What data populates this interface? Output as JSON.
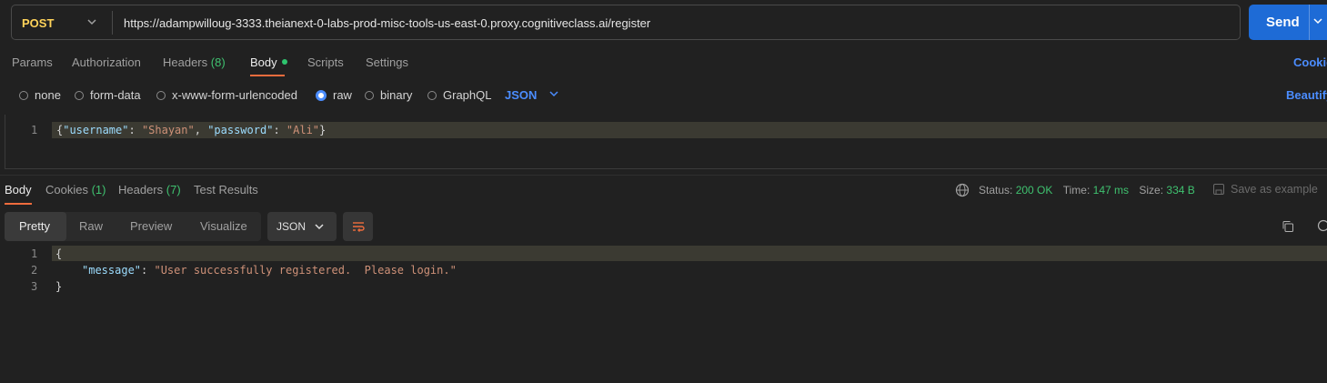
{
  "request": {
    "method": "POST",
    "url": "https://adampwilloug-3333.theianext-0-labs-prod-misc-tools-us-east-0.proxy.cognitiveclass.ai/register",
    "send_label": "Send"
  },
  "request_tabs": [
    {
      "label": "Params"
    },
    {
      "label": "Authorization"
    },
    {
      "label": "Headers",
      "count": "(8)"
    },
    {
      "label": "Body"
    },
    {
      "label": "Scripts"
    },
    {
      "label": "Settings"
    }
  ],
  "cookies_link": "Cookie",
  "body_types": [
    "none",
    "form-data",
    "x-www-form-urlencoded",
    "raw",
    "binary",
    "GraphQL"
  ],
  "body_type_selected": "raw",
  "body_language": "JSON",
  "beautify_label": "Beautify",
  "request_body": {
    "line_number": "1",
    "key1": "\"username\"",
    "val1": "\"Shayan\"",
    "key2": "\"password\"",
    "val2": "\"Ali\""
  },
  "response_tabs": [
    {
      "label": "Body"
    },
    {
      "label": "Cookies",
      "count": "(1)"
    },
    {
      "label": "Headers",
      "count": "(7)"
    },
    {
      "label": "Test Results"
    }
  ],
  "response_meta": {
    "status_label": "Status:",
    "status_value": "200 OK",
    "time_label": "Time:",
    "time_value": "147 ms",
    "size_label": "Size:",
    "size_value": "334 B",
    "save_label": "Save as example"
  },
  "view_modes": [
    "Pretty",
    "Raw",
    "Preview",
    "Visualize"
  ],
  "response_format": "JSON",
  "response_body": {
    "lines": [
      "1",
      "2",
      "3"
    ],
    "open": "{",
    "key": "\"message\"",
    "value": "\"User successfully registered.  Please login.\"",
    "close": "}"
  },
  "colors": {
    "accent": "#1e6bd6",
    "link": "#4b8dff",
    "method": "#ffd35a",
    "success": "#3fc16f",
    "tab_underline": "#ef6c3d"
  }
}
